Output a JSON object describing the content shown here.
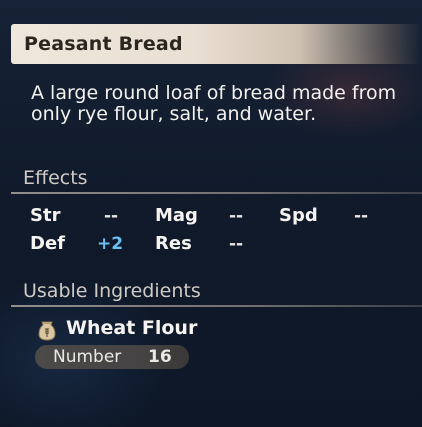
{
  "item": {
    "name": "Peasant Bread",
    "description": "A large round loaf of bread made from only rye flour, salt, and water."
  },
  "effects": {
    "header": "Effects",
    "stats": [
      {
        "label": "Str",
        "value": "--",
        "boost": false
      },
      {
        "label": "Mag",
        "value": "--",
        "boost": false
      },
      {
        "label": "Spd",
        "value": "--",
        "boost": false
      },
      {
        "label": "Def",
        "value": "+2",
        "boost": true
      },
      {
        "label": "Res",
        "value": "--",
        "boost": false
      }
    ]
  },
  "ingredients": {
    "header": "Usable Ingredients",
    "items": [
      {
        "name": "Wheat Flour",
        "icon": "flour-sack-icon",
        "number_label": "Number",
        "number": "16"
      }
    ]
  },
  "colors": {
    "title_bar": "#efe7dc",
    "background": "#101a2b",
    "boost": "#6fc0f2",
    "pill": "#4c4a49"
  }
}
